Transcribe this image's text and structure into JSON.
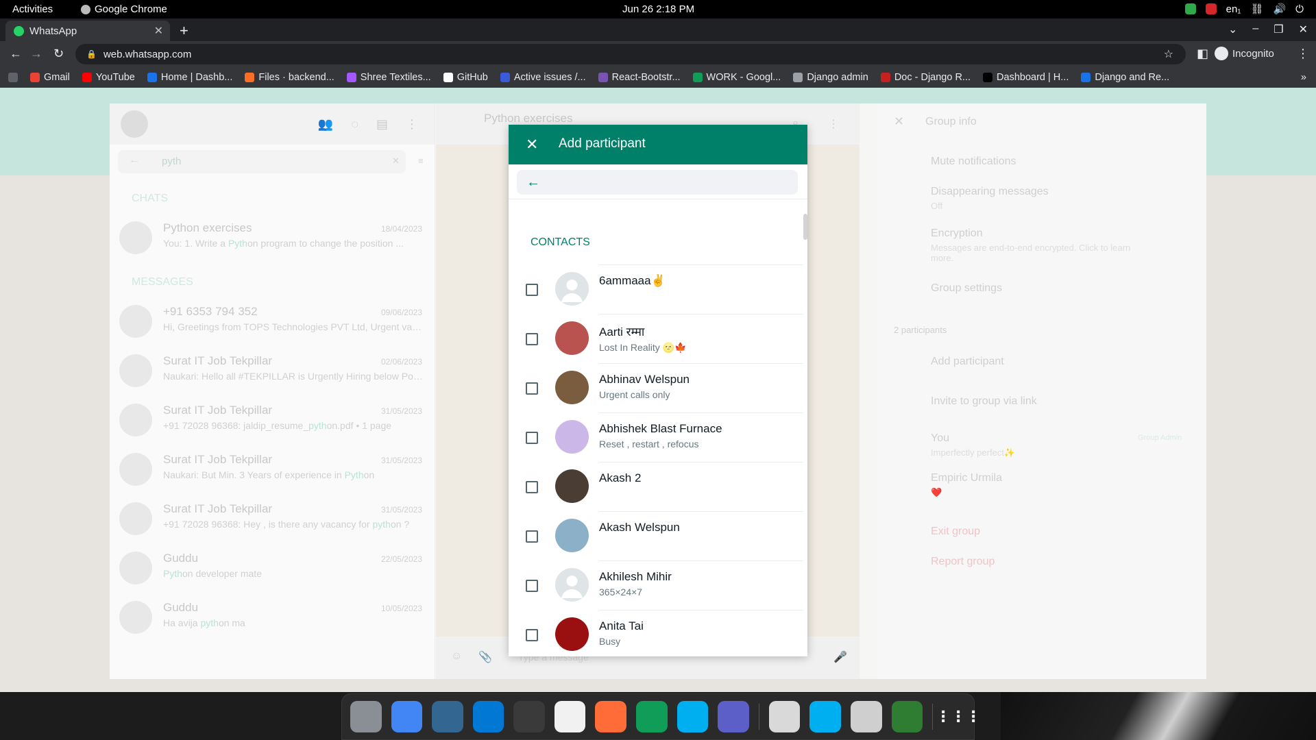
{
  "system": {
    "activities": "Activities",
    "app_name": "Google Chrome",
    "clock": "Jun 26  2:18 PM",
    "lang": "en₁"
  },
  "browser": {
    "tab_title": "WhatsApp",
    "url": "web.whatsapp.com",
    "profile": "Incognito",
    "bookmarks": [
      {
        "label": "",
        "color": "#5f6368"
      },
      {
        "label": "Gmail",
        "color": "#ea4335"
      },
      {
        "label": "YouTube",
        "color": "#ff0000"
      },
      {
        "label": "Home | Dashb...",
        "color": "#1a73e8"
      },
      {
        "label": "Files · backend...",
        "color": "#fc6d26"
      },
      {
        "label": "Shree Textiles...",
        "color": "#a259ff"
      },
      {
        "label": "GitHub",
        "color": "#ffffff"
      },
      {
        "label": "Active issues /...",
        "color": "#3b5bdb"
      },
      {
        "label": "React-Bootstr...",
        "color": "#7952b3"
      },
      {
        "label": "WORK - Googl...",
        "color": "#0f9d58"
      },
      {
        "label": "Django admin",
        "color": "#9aa0a6"
      },
      {
        "label": "Doc - Django R...",
        "color": "#c5221f"
      },
      {
        "label": "Dashboard | H...",
        "color": "#000000"
      },
      {
        "label": "Django and Re...",
        "color": "#1a73e8"
      }
    ]
  },
  "background": {
    "left": {
      "search_value": "pyth",
      "chats_heading": "CHATS",
      "messages_heading": "MESSAGES",
      "chats": [
        {
          "name": "Python exercises",
          "date": "18/04/2023",
          "preview": "You: 1. Write a Python program to change the position ..."
        }
      ],
      "messages": [
        {
          "name": "+91 6353 794 352",
          "date": "09/06/2023",
          "preview": "Hi, Greetings from TOPS Technologies PVT Ltd, Urgent vacancy for..."
        },
        {
          "name": "Surat IT Job Tekpillar",
          "date": "02/06/2023",
          "preview": "Naukari: Hello all  #TEKPILLAR is Urgently Hiring below Positions : ..."
        },
        {
          "name": "Surat IT Job Tekpillar",
          "date": "31/05/2023",
          "preview": "+91 72028 96368: jaldip_resume_python.pdf • 1 page"
        },
        {
          "name": "Surat IT Job Tekpillar",
          "date": "31/05/2023",
          "preview": "Naukari: But Min. 3 Years of experience in Python"
        },
        {
          "name": "Surat IT Job Tekpillar",
          "date": "31/05/2023",
          "preview": "+91 72028 96368: Hey , is there any vacancy for python  ?"
        },
        {
          "name": "Guddu",
          "date": "22/05/2023",
          "preview": "Python developer mate"
        },
        {
          "name": "Guddu",
          "date": "10/05/2023",
          "preview": "Ha avija python ma"
        }
      ]
    },
    "middle": {
      "title": "Python exercises",
      "message_placeholder": "Type a message"
    },
    "right": {
      "title": "Group info",
      "mute": "Mute notifications",
      "disappearing": "Disappearing messages",
      "disappearing_sub": "Off",
      "encryption": "Encryption",
      "encryption_sub": "Messages are end-to-end encrypted. Click to learn more.",
      "group_settings": "Group settings",
      "participants_count": "2 participants",
      "add_participant": "Add participant",
      "invite": "Invite to group via link",
      "you": "You",
      "you_status": "Imperfectly perfect✨",
      "group_admin": "Group Admin",
      "member": "Empiric Urmila",
      "member_status": "❤️",
      "exit": "Exit group",
      "report": "Report group"
    }
  },
  "modal": {
    "title": "Add participant",
    "search_value": "",
    "contacts_heading": "CONTACTS",
    "contacts": [
      {
        "name": "6ammaaa✌️",
        "status": "",
        "avatar_color": "#dfe5e7"
      },
      {
        "name": "Aarti रम्मा",
        "status": "Lost In Reality 🌝🍁",
        "avatar_color": "#b9534f"
      },
      {
        "name": "Abhinav Welspun",
        "status": "Urgent calls only",
        "avatar_color": "#7a5c3e"
      },
      {
        "name": "Abhishek Blast Furnace",
        "status": "Reset , restart , refocus",
        "avatar_color": "#cbb8e8"
      },
      {
        "name": "Akash 2",
        "status": "",
        "avatar_color": "#4a3d34"
      },
      {
        "name": "Akash Welspun",
        "status": "",
        "avatar_color": "#8db0c9"
      },
      {
        "name": "Akhilesh Mihir",
        "status": "365×24×7",
        "avatar_color": "#dfe5e7"
      },
      {
        "name": "Anita Tai",
        "status": "Busy",
        "avatar_color": "#9a1010"
      }
    ]
  },
  "dock": [
    {
      "name": "files-icon",
      "color": "#8a8f95"
    },
    {
      "name": "chrome-icon",
      "color": "#4285f4"
    },
    {
      "name": "postgres-icon",
      "color": "#336791"
    },
    {
      "name": "vscode-icon",
      "color": "#0078d4"
    },
    {
      "name": "terminal-icon",
      "color": "#3a3a3a"
    },
    {
      "name": "text-editor-icon",
      "color": "#f1f1f1"
    },
    {
      "name": "postman-icon",
      "color": "#ff6c37"
    },
    {
      "name": "sheets-icon",
      "color": "#0f9d58"
    },
    {
      "name": "skype-icon",
      "color": "#00aff0"
    },
    {
      "name": "teams-icon",
      "color": "#5b5fc7"
    },
    {
      "name": "screenshot-icon",
      "color": "#d9d9d9"
    },
    {
      "name": "skype2-icon",
      "color": "#00aff0"
    },
    {
      "name": "document-icon",
      "color": "#cfcfcf"
    },
    {
      "name": "recycle-icon",
      "color": "#2e7d32"
    },
    {
      "name": "app-grid-icon",
      "color": "#2a2a2a"
    }
  ]
}
